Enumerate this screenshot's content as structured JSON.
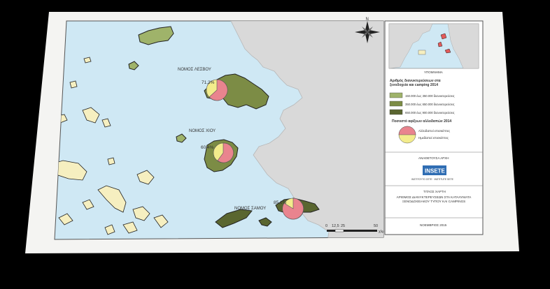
{
  "map": {
    "nomos_lesvos": "ΝΟΜΟΣ ΛΕΣΒΟΥ",
    "nomos_chios": "ΝΟΜΟΣ ΧΙΟΥ",
    "nomos_samos": "ΝΟΜΟΣ ΣΑΜΟΥ",
    "pct_lesvos": "71,2%",
    "pct_chios": "60,4%",
    "pct_samos": "85,1%",
    "scale_labels": [
      "0",
      "12,5",
      "25",
      "50"
    ],
    "scale_unit": "χλμ",
    "compass": "N"
  },
  "legend": {
    "inset_caption": "ΥΠΟΜΝΗΜΑ",
    "title1": "Αριθμός διανυκτερεύσεων στα ξενοδοχεία και camping 2014",
    "classes": [
      {
        "label": "150.000 έως 350.000 διανυκτερεύσεις",
        "color": "#9fb36a"
      },
      {
        "label": "350.000 έως 650.000 διανυκτερεύσεις",
        "color": "#7c8c45"
      },
      {
        "label": "650.000 έως 900.000 διανυκτερεύσεις",
        "color": "#5a6630"
      }
    ],
    "title2": "Ποσοστό αφίξεων αλλοδαπών 2014",
    "pie_labels": [
      "Αλλοδαποί επισκέπτες",
      "Ημεδαποί επισκέπτες"
    ],
    "pie_colors": [
      "#e9848e",
      "#f3ec8c"
    ],
    "authority_caption": "ΑΝΑΘΕΤΟΥΣΑ ΑΡΧΗ",
    "logo_text": "INSETE",
    "logo_sub": "ΙΝΣΤΙΤΟΥΤΟ ΣΕΤΕ · INSTITUTE SETE",
    "map_title_caption": "ΤΙΤΛΟΣ ΧΑΡΤΗ",
    "map_title": "ΑΡΙΘΜΟΣ ΔΙΑΝΥΚΤΕΡΕΥΣΕΩΝ ΣΤΑ ΚΑΤΑΛΥΜΑΤΑ ΞΕΝΟΔΟΧΕΙΑΚΟΥ ΤΥΠΟΥ ΚΑΙ CAMPINGS",
    "date": "ΝΟΕΜΒΡΙΟΣ 2015"
  }
}
